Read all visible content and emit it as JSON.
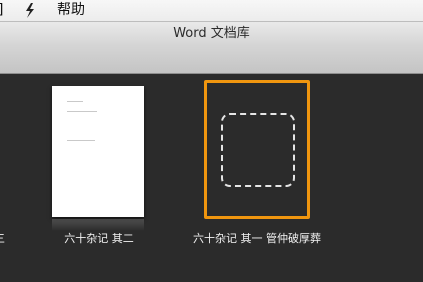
{
  "menubar": {
    "edge_item": "]",
    "help_label": "帮助"
  },
  "icons": {
    "script_icon": "script-icon"
  },
  "window": {
    "title": "Word 文档库"
  },
  "left_edge_label": "三",
  "documents": [
    {
      "label": "六十杂记 其二"
    },
    {
      "label": "六十杂记 其一 管仲破厚葬"
    }
  ],
  "colors": {
    "selection": "#f0960f",
    "background": "#2b2b2b"
  }
}
